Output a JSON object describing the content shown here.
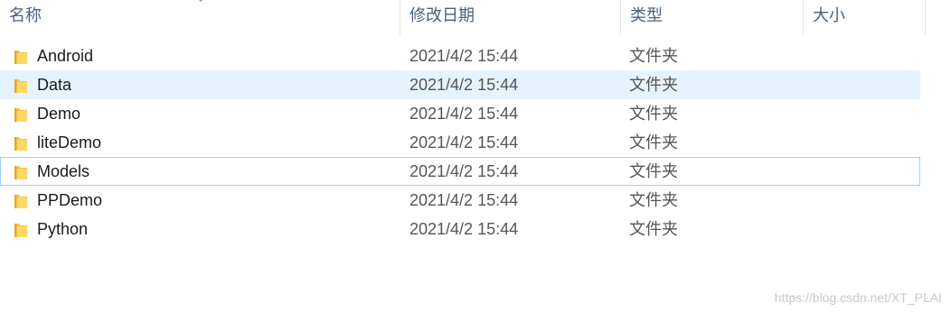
{
  "columns": {
    "name": "名称",
    "date": "修改日期",
    "type": "类型",
    "size": "大小"
  },
  "sort": {
    "column": "name",
    "icon": "sort-arrow-icon"
  },
  "items": [
    {
      "name": "Android",
      "date": "2021/4/2 15:44",
      "type": "文件夹",
      "size": "",
      "icon": "folder-icon"
    },
    {
      "name": "Data",
      "date": "2021/4/2 15:44",
      "type": "文件夹",
      "size": "",
      "icon": "folder-icon",
      "state": "hover"
    },
    {
      "name": "Demo",
      "date": "2021/4/2 15:44",
      "type": "文件夹",
      "size": "",
      "icon": "folder-icon"
    },
    {
      "name": "liteDemo",
      "date": "2021/4/2 15:44",
      "type": "文件夹",
      "size": "",
      "icon": "folder-icon"
    },
    {
      "name": "Models",
      "date": "2021/4/2 15:44",
      "type": "文件夹",
      "size": "",
      "icon": "folder-icon",
      "state": "focused"
    },
    {
      "name": "PPDemo",
      "date": "2021/4/2 15:44",
      "type": "文件夹",
      "size": "",
      "icon": "folder-icon"
    },
    {
      "name": "Python",
      "date": "2021/4/2 15:44",
      "type": "文件夹",
      "size": "",
      "icon": "folder-icon"
    }
  ],
  "watermark": "https://blog.csdn.net/XT_PLAI",
  "colors": {
    "hover_bg": "#e5f3ff",
    "focus_border": "#99d1ff",
    "header_text": "#4c607a",
    "folder_yellow": "#f5c242"
  }
}
